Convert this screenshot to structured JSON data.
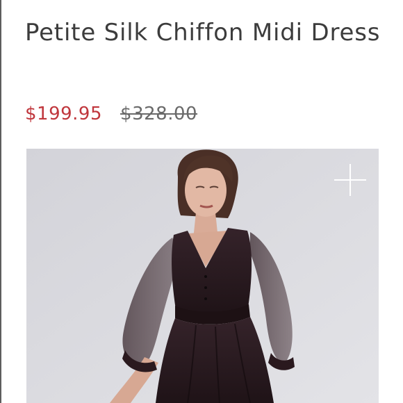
{
  "product": {
    "title": "Petite Silk Chiffon Midi Dress",
    "sale_price": "$199.95",
    "original_price": "$328.00"
  },
  "colors": {
    "sale_price": "#c0363c",
    "original_price": "#6a6a6a",
    "title": "#3c3c3c",
    "photo_background": "#d8d8dd",
    "dress": "#2a1a1e"
  },
  "icons": {
    "zoom": "plus-icon"
  }
}
